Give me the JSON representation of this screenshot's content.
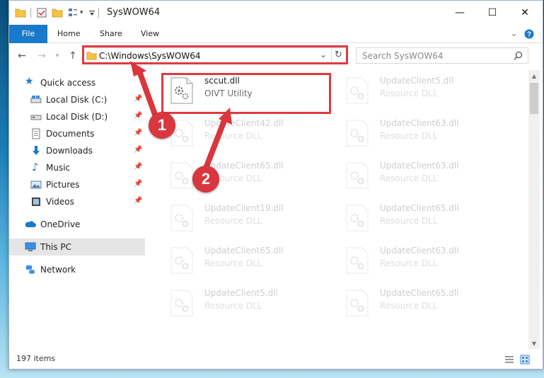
{
  "window": {
    "title": "SysWOW64",
    "controls": {
      "minimize": "—",
      "maximize": "☐",
      "close": "✕"
    }
  },
  "ribbon": {
    "tabs": [
      "File",
      "Home",
      "Share",
      "View"
    ],
    "collapse_icon": "chevron-down",
    "help_icon": "help"
  },
  "navigation": {
    "address_path": "C:\\Windows\\SysWOW64",
    "search_placeholder": "Search SysWOW64"
  },
  "sidebar": {
    "quick_access": "Quick access",
    "items": [
      {
        "label": "Local Disk (C:)",
        "icon": "drive",
        "pinned": true
      },
      {
        "label": "Local Disk (D:)",
        "icon": "drive",
        "pinned": true
      },
      {
        "label": "Documents",
        "icon": "documents",
        "pinned": true
      },
      {
        "label": "Downloads",
        "icon": "downloads",
        "pinned": true
      },
      {
        "label": "Music",
        "icon": "music",
        "pinned": true
      },
      {
        "label": "Pictures",
        "icon": "pictures",
        "pinned": true
      },
      {
        "label": "Videos",
        "icon": "videos",
        "pinned": true
      }
    ],
    "onedrive": "OneDrive",
    "this_pc": "This PC",
    "network": "Network"
  },
  "files": [
    {
      "name": "sccut.dll",
      "description": "OIVT Utility",
      "highlighted": true
    },
    {
      "name": "UpdateClient5.dll",
      "description": "Resource DLL"
    },
    {
      "name": "UpdateClient42.dll",
      "description": "Resource DLL"
    },
    {
      "name": "UpdateClient63.dll",
      "description": "Resource DLL"
    },
    {
      "name": "UpdateClient65.dll",
      "description": "Resource DLL"
    },
    {
      "name": "UpdateClient63.dll",
      "description": "Resource DLL"
    },
    {
      "name": "UpdateClient19.dll",
      "description": "Resource DLL"
    },
    {
      "name": "UpdateClient65.dll",
      "description": "Resource DLL"
    },
    {
      "name": "UpdateClient65.dll",
      "description": "Resource DLL"
    },
    {
      "name": "UpdateClient63.dll",
      "description": "Resource DLL"
    },
    {
      "name": "UpdateClient5.dll",
      "description": "Resource DLL"
    },
    {
      "name": "UpdateClient65.dll",
      "description": "Resource DLL"
    }
  ],
  "status": {
    "item_count": "197 items"
  },
  "annotations": {
    "step1": "1",
    "step2": "2",
    "color": "#e03a3f"
  }
}
